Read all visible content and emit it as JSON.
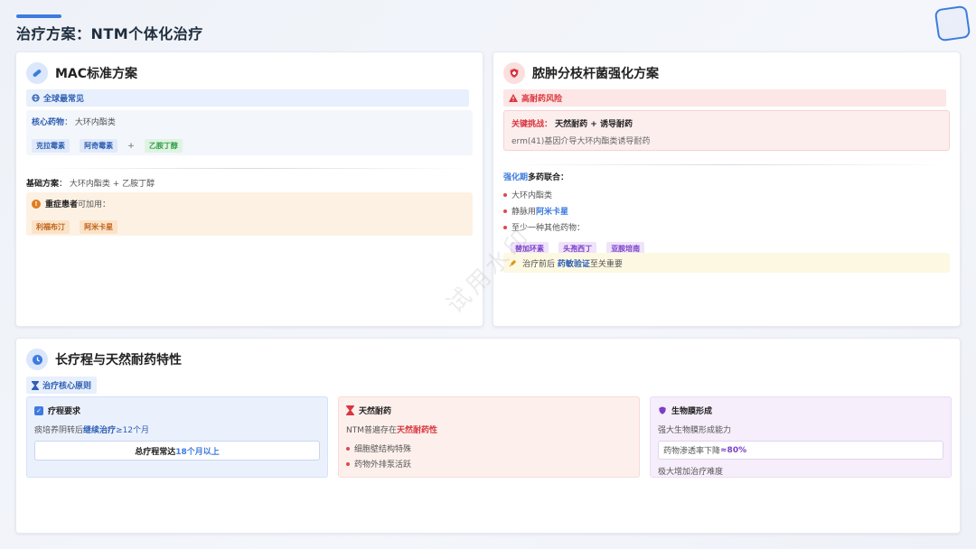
{
  "page_title": "治疗方案：NTM个体化治疗",
  "colors": {
    "accent": "#3d7be0",
    "red": "#d9363e",
    "green": "#2f9e44",
    "orange": "#e07b1f",
    "purple": "#7b3fc6"
  },
  "mac": {
    "title": "MAC标准方案",
    "icon": "pill-icon",
    "tag": "全球最常见",
    "core_label": "核心药物",
    "core_value": "大环内酯类",
    "drugs": [
      "克拉霉素",
      "阿奇霉素"
    ],
    "plus": "+",
    "drug_extra": "乙胺丁醇",
    "base_label": "基础方案",
    "base_value": "大环内酯类 + 乙胺丁醇",
    "severe_bold": "重症患者",
    "severe_rest": "可加用：",
    "severe_drugs": [
      "利福布汀",
      "阿米卡星"
    ]
  },
  "abscessus": {
    "title": "脓肿分枝杆菌强化方案",
    "icon": "shield-icon",
    "risk_tag": "高耐药风险",
    "challenge_label": "关键挑战",
    "challenge_value": "天然耐药 + 诱导耐药",
    "challenge_desc": "erm(41)基因介导大环内酯类诱导耐药",
    "phase_blue": "强化期",
    "phase_rest": "多药联合：",
    "items": [
      "大环内酯类"
    ],
    "iv_prefix": "静脉用",
    "iv_drug": "阿米卡星",
    "other_item": "至少一种其他药物：",
    "other_drugs": [
      "替加环素",
      "头孢西丁",
      "亚胺培南"
    ],
    "tip_prefix": "治疗前后",
    "tip_bold": "药敏验证",
    "tip_suffix": "至关重要"
  },
  "long_course": {
    "title": "长疗程与天然耐药特性",
    "icon": "clock-icon",
    "principle_tag": "治疗核心原则",
    "course": {
      "title": "疗程要求",
      "text_prefix": "痰培养阴转后",
      "text_bold": "继续治疗",
      "text_suffix": "≥12个月",
      "box_prefix": "总疗程常达",
      "box_bold": "18个月以上"
    },
    "resistance": {
      "title": "天然耐药",
      "text_prefix": "NTM普遍存在",
      "text_bold": "天然耐药性",
      "bullets": [
        "细胞壁结构特殊",
        "药物外排泵活跃"
      ]
    },
    "biofilm": {
      "title": "生物膜形成",
      "text": "强大生物膜形成能力",
      "box_prefix": "药物渗透率下降",
      "box_bold": "≈80%",
      "footer": "极大增加治疗难度"
    }
  },
  "watermark": "试用水印"
}
